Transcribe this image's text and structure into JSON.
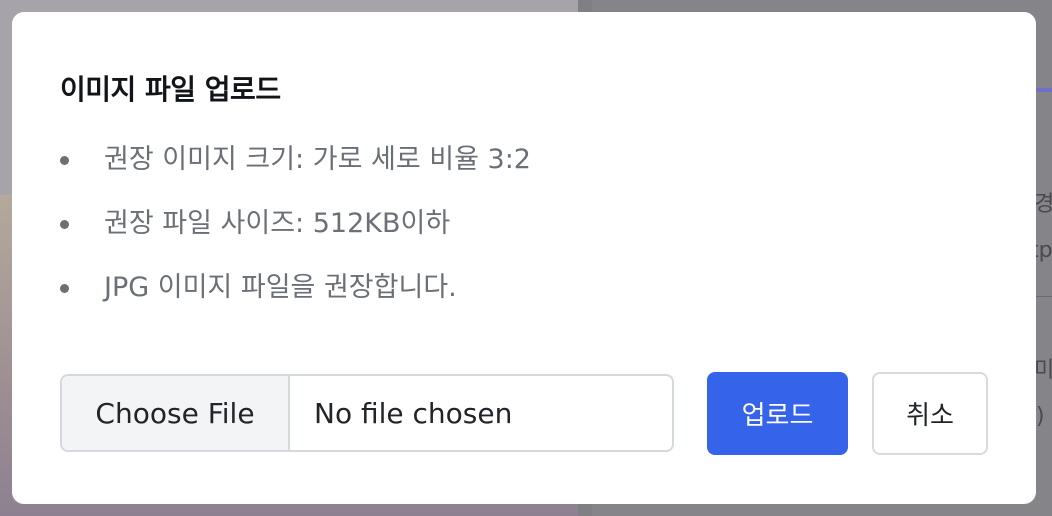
{
  "modal": {
    "title": "이미지 파일 업로드",
    "guidelines": [
      "권장 이미지 크기: 가로 세로 비율 3:2",
      "권장 파일 사이즈: 512KB이하",
      "JPG 이미지 파일을 권장합니다."
    ],
    "file_input": {
      "button_label": "Choose File",
      "status": "No file chosen"
    },
    "upload_label": "업로드",
    "cancel_label": "취소"
  },
  "background": {
    "fragments": [
      "경",
      "tp",
      "미",
      ")"
    ]
  },
  "colors": {
    "primary": "#3563e9",
    "title": "#111418",
    "muted_text": "#6b6f76",
    "border": "#d5d8dc",
    "overlay": "#8c8c90"
  }
}
